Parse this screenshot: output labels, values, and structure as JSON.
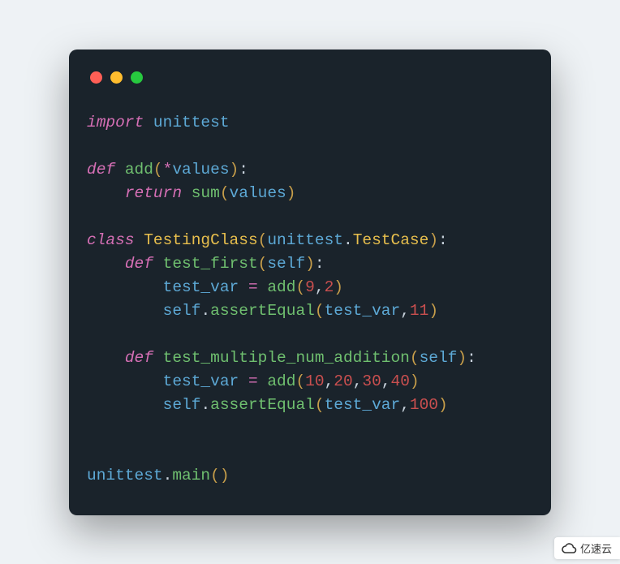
{
  "window": {
    "traffic_lights": [
      "red",
      "yellow",
      "green"
    ]
  },
  "code": {
    "l1_import": "import",
    "l1_module": "unittest",
    "l3_def": "def",
    "l3_fn": "add",
    "l3_star": "*",
    "l3_param": "values",
    "l4_return": "return",
    "l4_call": "sum",
    "l4_arg": "values",
    "l6_class": "class",
    "l6_name": "TestingClass",
    "l6_base_mod": "unittest",
    "l6_base_cls": "TestCase",
    "l7_def": "def",
    "l7_fn": "test_first",
    "l7_self": "self",
    "l8_var": "test_var",
    "l8_eq": "=",
    "l8_call": "add",
    "l8_a1": "9",
    "l8_a2": "2",
    "l9_self": "self",
    "l9_method": "assertEqual",
    "l9_arg1": "test_var",
    "l9_arg2": "11",
    "l11_def": "def",
    "l11_fn": "test_multiple_num_addition",
    "l11_self": "self",
    "l12_var": "test_var",
    "l12_eq": "=",
    "l12_call": "add",
    "l12_a1": "10",
    "l12_a2": "20",
    "l12_a3": "30",
    "l12_a4": "40",
    "l13_self": "self",
    "l13_method": "assertEqual",
    "l13_arg1": "test_var",
    "l13_arg2": "100",
    "l16_mod": "unittest",
    "l16_call": "main"
  },
  "watermark": {
    "text": "亿速云"
  }
}
